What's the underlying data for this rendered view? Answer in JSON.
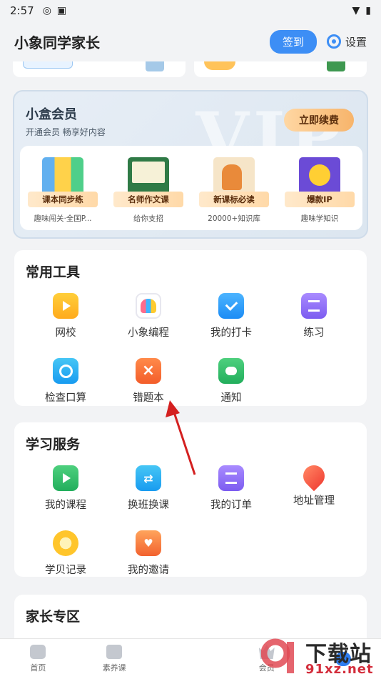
{
  "status_bar": {
    "time": "2:57"
  },
  "header": {
    "title": "小象同学家长",
    "signin_label": "签到",
    "settings_label": "设置"
  },
  "vip": {
    "bg_text": "VIP",
    "title": "小盒会员",
    "subtitle": "开通会员 畅享好内容",
    "renew_label": "立即续费",
    "items": [
      {
        "badge": "课本同步练",
        "desc": "趣味闯关·全国P..."
      },
      {
        "badge": "名师作文课",
        "desc": "给你支招"
      },
      {
        "badge": "新课标必读",
        "desc": "20000+知识库"
      },
      {
        "badge": "爆款IP",
        "desc": "趣味学知识"
      }
    ]
  },
  "tools": {
    "title": "常用工具",
    "items": [
      {
        "label": "网校",
        "icon": "video-folder-icon"
      },
      {
        "label": "小象编程",
        "icon": "elephant-icon"
      },
      {
        "label": "我的打卡",
        "icon": "calendar-check-icon"
      },
      {
        "label": "练习",
        "icon": "practice-icon"
      },
      {
        "label": "检查口算",
        "icon": "camera-icon"
      },
      {
        "label": "错题本",
        "icon": "error-book-icon"
      },
      {
        "label": "通知",
        "icon": "chat-bubble-icon"
      }
    ]
  },
  "services": {
    "title": "学习服务",
    "items": [
      {
        "label": "我的课程",
        "icon": "course-play-icon"
      },
      {
        "label": "换班换课",
        "icon": "swap-class-icon"
      },
      {
        "label": "我的订单",
        "icon": "order-icon"
      },
      {
        "label": "地址管理",
        "icon": "location-pin-icon"
      },
      {
        "label": "学贝记录",
        "icon": "coin-icon"
      },
      {
        "label": "我的邀请",
        "icon": "invite-envelope-icon"
      }
    ]
  },
  "parents": {
    "title": "家长专区"
  },
  "bottom_nav": [
    {
      "label": "首页",
      "icon": "home-icon"
    },
    {
      "label": "素养课",
      "icon": "tv-icon"
    },
    {
      "label": "",
      "icon": ""
    },
    {
      "label": "会员",
      "icon": "crown-icon"
    },
    {
      "label": "我的",
      "icon": "cloud-icon"
    }
  ],
  "watermark": {
    "top": "下载站",
    "bottom": "91xz.net"
  },
  "colors": {
    "accent": "#3d8ef5",
    "annotation_arrow": "#d42020",
    "watermark_red": "#d32d3b"
  }
}
